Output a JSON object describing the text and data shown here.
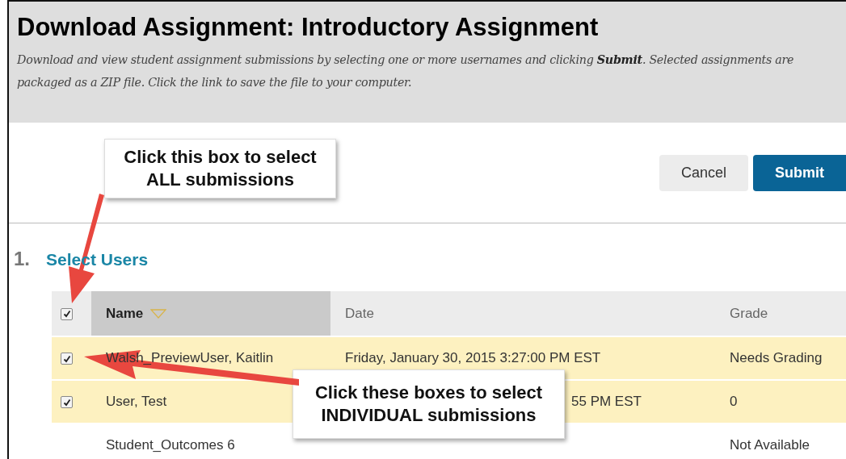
{
  "header": {
    "title": "Download Assignment: Introductory Assignment",
    "description": "Download and view student assignment submissions by selecting one or more usernames and clicking **Submit**. Selected assignments are packaged as a ZIP file. Click the link to save the file to your computer."
  },
  "buttons": [
    {
      "label": "Cancel",
      "kind": "secondary"
    },
    {
      "label": "Submit",
      "kind": "primary"
    }
  ],
  "step": {
    "number": "1.",
    "title": "Select Users"
  },
  "table": {
    "select_all": {
      "checked": true
    },
    "columns": [
      "Name",
      "Date",
      "Grade"
    ],
    "rows": [
      {
        "name": "Walsh_PreviewUser, Kaitlin",
        "date": "Friday, January 30, 2015 3:27:00 PM EST",
        "grade": "Needs Grading",
        "checked": true
      },
      {
        "name": "User, Test",
        "date": "55 PM EST",
        "grade": "0",
        "checked": true
      },
      {
        "name": "Student_Outcomes 6",
        "grade": "Not Available"
      }
    ]
  },
  "callouts": [
    {
      "text": "Click this box to select ALL submissions"
    },
    {
      "text": "Click these boxes to select INDIVIDUAL submissions"
    }
  ]
}
